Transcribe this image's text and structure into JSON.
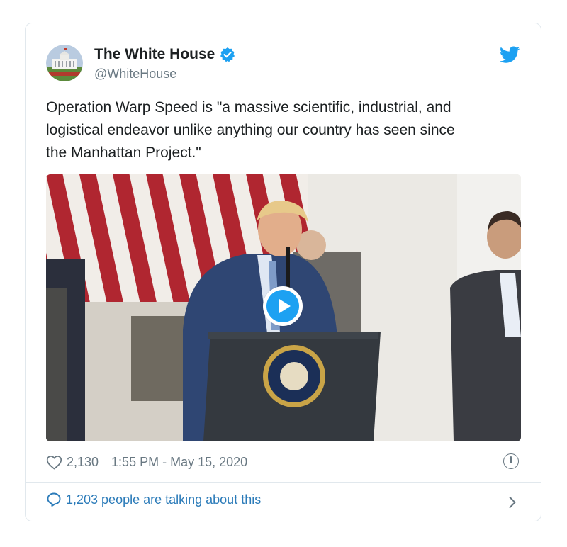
{
  "tweet": {
    "author_name": "The White House",
    "author_handle": "@WhiteHouse",
    "verified": true,
    "text": "Operation Warp Speed is \"a massive scientific, industrial, and\nlogistical endeavor unlike anything our country has seen since\nthe Manhattan Project.\"",
    "media": {
      "type": "video",
      "play_icon": "play-icon"
    },
    "likes": "2,130",
    "timestamp": "1:55 PM - May 15, 2020",
    "conversation": "1,203 people are talking about this"
  },
  "icons": {
    "brand": "twitter-bird-icon",
    "verified": "verified-badge-icon",
    "like": "heart-icon",
    "info": "info-icon",
    "reply": "reply-bubble-icon",
    "chevron": "chevron-right-icon"
  },
  "colors": {
    "accent": "#1da1f2",
    "link": "#2b7bb9",
    "text": "#1c2022",
    "muted": "#697882",
    "border": "#e1e8ed"
  }
}
